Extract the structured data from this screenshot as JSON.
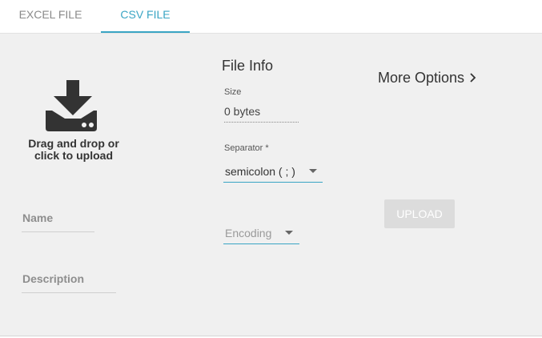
{
  "tabs": [
    {
      "label": "EXCEL FILE",
      "active": false
    },
    {
      "label": "CSV FILE",
      "active": true
    }
  ],
  "accent_color": "#3aa5c4",
  "drop_zone": {
    "icon": "download-icon",
    "text": "Drag and drop or click to upload"
  },
  "name_field": {
    "label": "Name",
    "value": ""
  },
  "description_field": {
    "label": "Description",
    "value": ""
  },
  "file_info": {
    "title": "File Info",
    "size_label": "Size",
    "size_value": "0 bytes",
    "separator_label": "Separator *",
    "separator_value": "semicolon ( ; )",
    "encoding_placeholder": "Encoding"
  },
  "more_options": {
    "label": "More Options",
    "chevron": "chevron-right-icon"
  },
  "upload_button": {
    "label": "UPLOAD",
    "disabled": true
  }
}
